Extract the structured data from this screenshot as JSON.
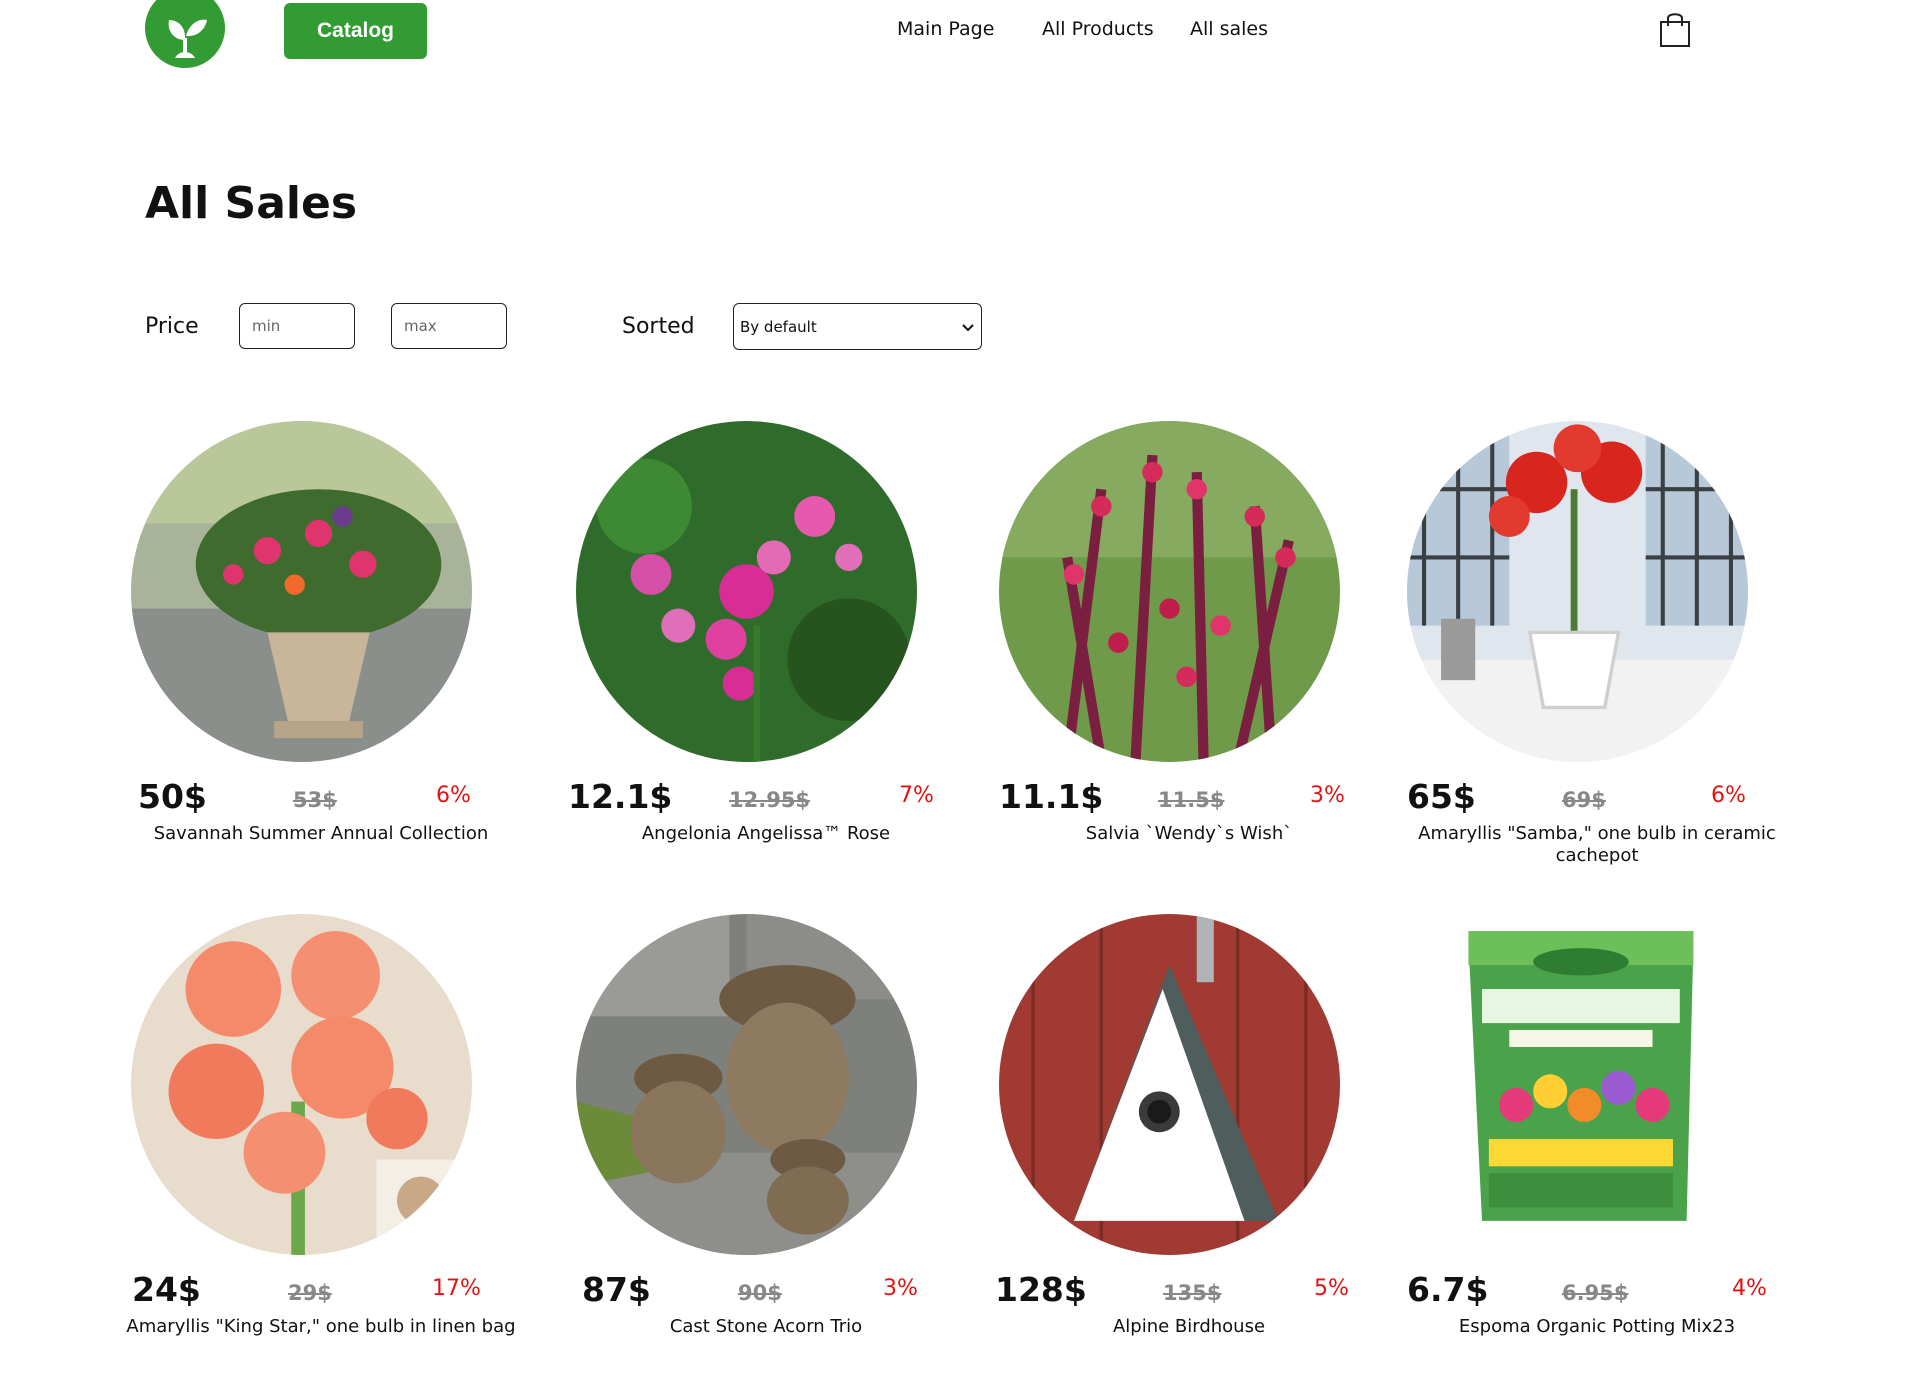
{
  "header": {
    "catalog_label": "Catalog",
    "nav": [
      "Main Page",
      "All Products",
      "All sales"
    ],
    "logo_icon": "leaf-sprout-icon",
    "cart_icon": "shopping-bag-icon",
    "brand_color": "#339b33"
  },
  "page": {
    "title": "All Sales"
  },
  "filters": {
    "price_label": "Price",
    "min_placeholder": "min",
    "max_placeholder": "max",
    "sort_label": "Sorted",
    "sort_selected": "By default"
  },
  "products": [
    {
      "price": "50$",
      "old_price": "53$",
      "discount": "6%",
      "name": "Savannah Summer Annual Collection"
    },
    {
      "price": "12.1$",
      "old_price": "12.95$",
      "discount": "7%",
      "name": "Angelonia Angelissa™ Rose"
    },
    {
      "price": "11.1$",
      "old_price": "11.5$",
      "discount": "3%",
      "name": "Salvia `Wendy`s Wish`"
    },
    {
      "price": "65$",
      "old_price": "69$",
      "discount": "6%",
      "name": "Amaryllis \"Samba,\" one bulb in ceramic cachepot"
    },
    {
      "price": "24$",
      "old_price": "29$",
      "discount": "17%",
      "name": "Amaryllis \"King Star,\" one bulb in linen bag"
    },
    {
      "price": "87$",
      "old_price": "90$",
      "discount": "3%",
      "name": "Cast Stone Acorn Trio"
    },
    {
      "price": "128$",
      "old_price": "135$",
      "discount": "5%",
      "name": "Alpine Birdhouse"
    },
    {
      "price": "6.7$",
      "old_price": "6.95$",
      "discount": "4%",
      "name": "Espoma Organic Potting Mix23"
    }
  ]
}
